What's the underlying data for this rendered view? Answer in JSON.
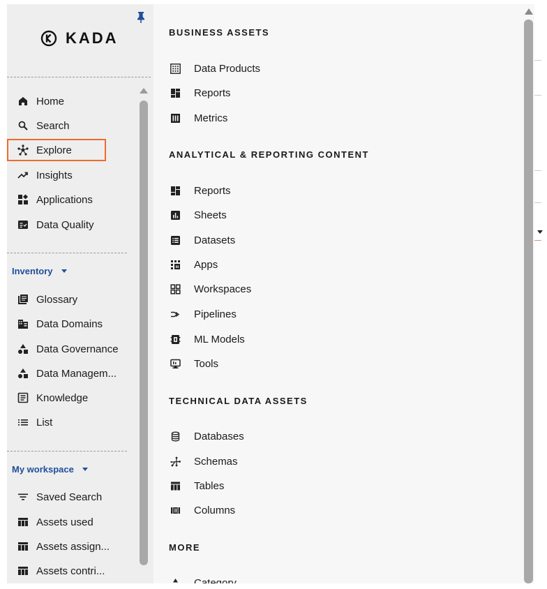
{
  "app": {
    "logo_text": "KADA"
  },
  "sidebar": {
    "main": [
      {
        "label": "Home",
        "icon": "home-icon"
      },
      {
        "label": "Search",
        "icon": "search-icon"
      },
      {
        "label": "Explore",
        "icon": "explore-icon",
        "highlighted": true
      },
      {
        "label": "Insights",
        "icon": "trending-up-icon"
      },
      {
        "label": "Applications",
        "icon": "widgets-icon"
      },
      {
        "label": "Data Quality",
        "icon": "fact-check-icon"
      }
    ],
    "inventory": {
      "title": "Inventory",
      "items": [
        {
          "label": "Glossary",
          "icon": "library-books-icon"
        },
        {
          "label": "Data Domains",
          "icon": "domain-icon"
        },
        {
          "label": "Data Governance",
          "icon": "shapes-icon"
        },
        {
          "label": "Data Managem...",
          "icon": "shapes-icon"
        },
        {
          "label": "Knowledge",
          "icon": "article-icon"
        },
        {
          "label": "List",
          "icon": "list-icon"
        }
      ]
    },
    "workspace": {
      "title": "My workspace",
      "items": [
        {
          "label": "Saved Search",
          "icon": "filter-list-icon"
        },
        {
          "label": "Assets used",
          "icon": "table-icon"
        },
        {
          "label": "Assets assign...",
          "icon": "table-icon"
        },
        {
          "label": "Assets contri...",
          "icon": "table-icon"
        }
      ]
    }
  },
  "panel": {
    "business": {
      "title": "BUSINESS ASSETS",
      "items": [
        {
          "label": "Data Products",
          "icon": "grid-dots-icon"
        },
        {
          "label": "Reports",
          "icon": "dashboard-icon"
        },
        {
          "label": "Metrics",
          "icon": "metrics-icon"
        }
      ]
    },
    "analytical": {
      "title": "ANALYTICAL & REPORTING CONTENT",
      "items": [
        {
          "label": "Reports",
          "icon": "dashboard-icon"
        },
        {
          "label": "Sheets",
          "icon": "bar-chart-box-icon"
        },
        {
          "label": "Datasets",
          "icon": "list-box-icon"
        },
        {
          "label": "Apps",
          "icon": "apps-icon"
        },
        {
          "label": "Workspaces",
          "icon": "grid-view-icon"
        },
        {
          "label": "Pipelines",
          "icon": "pipeline-icon"
        },
        {
          "label": "ML Models",
          "icon": "ml-model-icon"
        },
        {
          "label": "Tools",
          "icon": "monitor-icon"
        }
      ]
    },
    "technical": {
      "title": "TECHNICAL DATA ASSETS",
      "items": [
        {
          "label": "Databases",
          "icon": "database-icon"
        },
        {
          "label": "Schemas",
          "icon": "schema-icon"
        },
        {
          "label": "Tables",
          "icon": "table-icon"
        },
        {
          "label": "Columns",
          "icon": "columns-icon"
        }
      ]
    },
    "more": {
      "title": "MORE",
      "items": [
        {
          "label": "Category",
          "icon": "shapes-icon"
        }
      ]
    }
  },
  "colors": {
    "accent": "#1f4e9c",
    "highlight": "#f06a2b"
  }
}
